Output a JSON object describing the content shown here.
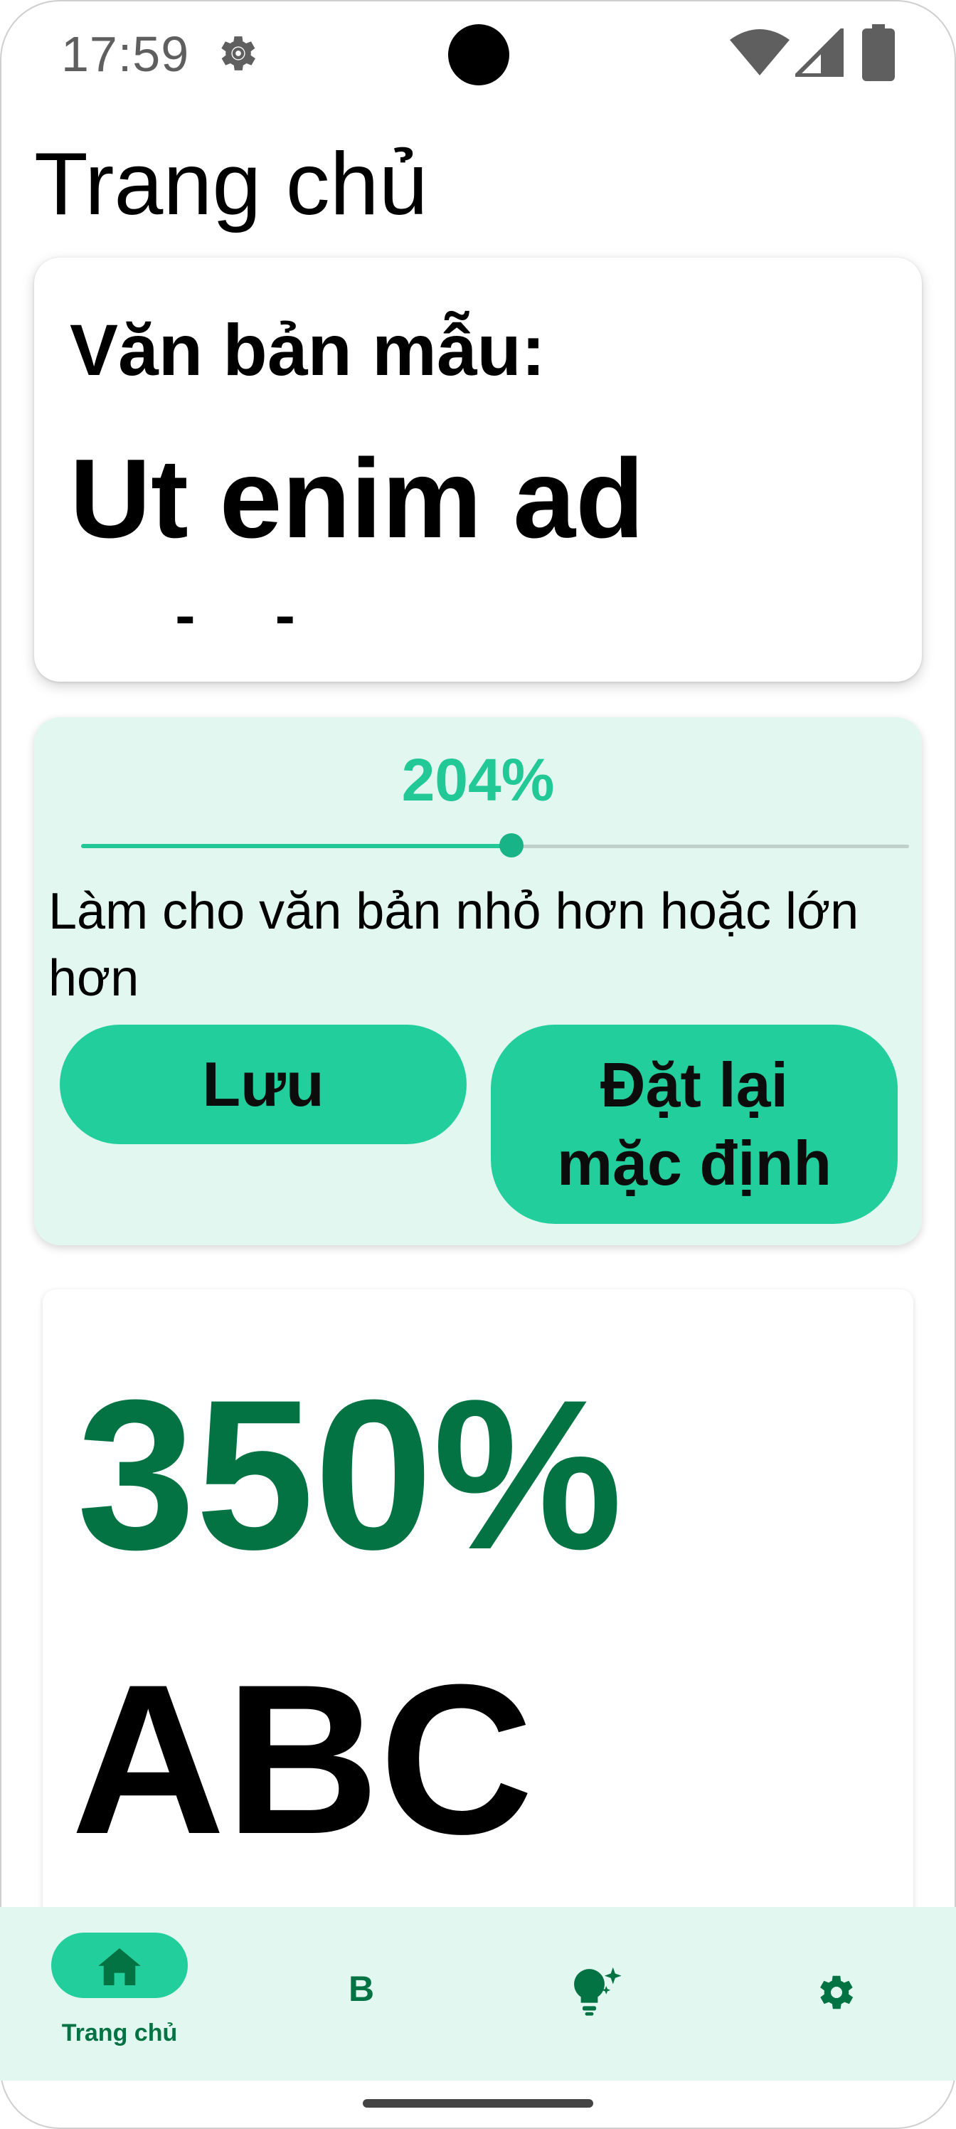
{
  "status_bar": {
    "time": "17:59",
    "icons": [
      "gear-icon",
      "wifi-icon",
      "signal-icon",
      "battery-icon"
    ]
  },
  "header": {
    "title": "Trang chủ"
  },
  "preview_card": {
    "label": "Văn bản mẫu:",
    "sample_text": "Ut enim ad minima"
  },
  "scale_control": {
    "value_text": "204%",
    "slider_fraction": 0.52,
    "helper_text": "Làm cho văn bản nhỏ hơn hoặc lớn hơn",
    "save_label": "Lưu",
    "reset_label": "Đặt lại mặc định"
  },
  "big_preview": {
    "percent": "350%",
    "sample": "ABC"
  },
  "bottom_nav": {
    "items": [
      {
        "label": "Trang chủ",
        "icon": "home-icon",
        "active": true
      },
      {
        "label": "",
        "icon": "bold-b-icon",
        "glyph": "B"
      },
      {
        "label": "",
        "icon": "lightbulb-sparkle-icon"
      },
      {
        "label": "",
        "icon": "gear-icon"
      }
    ]
  },
  "colors": {
    "accent": "#22cf9c",
    "accent_text": "#22c997",
    "dark_green": "#047343",
    "panel_bg": "#e3f7f1"
  }
}
